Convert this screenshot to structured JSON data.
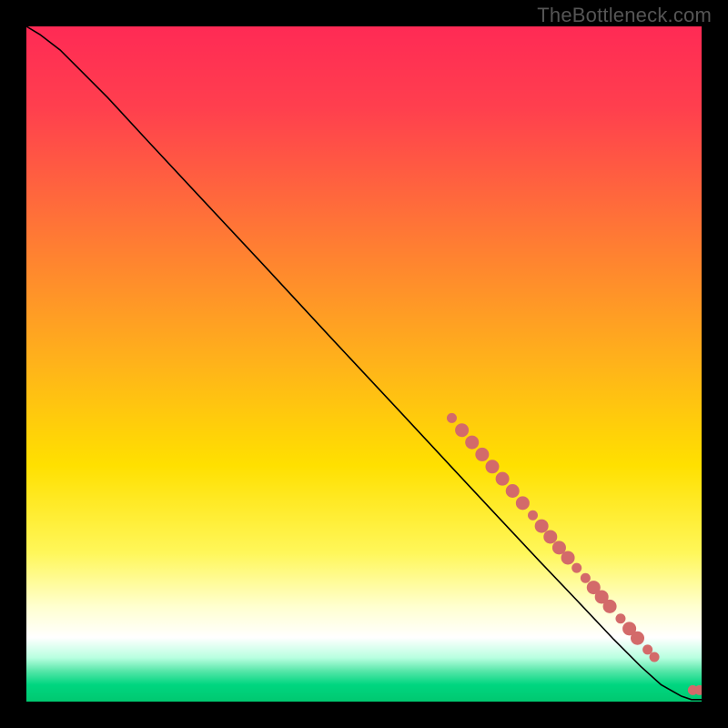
{
  "watermark": "TheBottleneck.com",
  "chart_data": {
    "type": "line",
    "title": "",
    "xlabel": "",
    "ylabel": "",
    "xlim": [
      0,
      100
    ],
    "ylim": [
      0,
      100
    ],
    "grid": false,
    "background_gradient": {
      "stops": [
        {
          "offset": 0.0,
          "color": "#ff2a55"
        },
        {
          "offset": 0.12,
          "color": "#ff3f4e"
        },
        {
          "offset": 0.3,
          "color": "#ff7636"
        },
        {
          "offset": 0.5,
          "color": "#ffb31a"
        },
        {
          "offset": 0.65,
          "color": "#ffe000"
        },
        {
          "offset": 0.78,
          "color": "#fff75a"
        },
        {
          "offset": 0.86,
          "color": "#ffffd0"
        },
        {
          "offset": 0.905,
          "color": "#ffffff"
        },
        {
          "offset": 0.935,
          "color": "#b8ffe0"
        },
        {
          "offset": 0.955,
          "color": "#55e6a8"
        },
        {
          "offset": 0.975,
          "color": "#00d680"
        },
        {
          "offset": 1.0,
          "color": "#00c870"
        }
      ]
    },
    "series": [
      {
        "name": "curve",
        "kind": "line",
        "color": "#000000",
        "x": [
          0,
          2,
          5,
          8,
          12,
          18,
          25,
          35,
          45,
          55,
          63,
          70,
          76,
          82,
          87,
          91,
          94,
          97,
          98.5,
          100
        ],
        "y": [
          100,
          98.8,
          96.5,
          93.5,
          89.5,
          83.0,
          75.5,
          64.8,
          54.0,
          43.3,
          34.7,
          27.2,
          20.8,
          14.5,
          9.2,
          5.2,
          2.5,
          0.8,
          0.3,
          0.3
        ]
      },
      {
        "name": "dots",
        "kind": "scatter",
        "color": "#d36a6a",
        "radius_small": 5.5,
        "radius_large": 7.5,
        "points": [
          {
            "x": 63.0,
            "y": 42.0,
            "r": "small"
          },
          {
            "x": 64.5,
            "y": 40.2,
            "r": "large"
          },
          {
            "x": 66.0,
            "y": 38.4,
            "r": "large"
          },
          {
            "x": 67.5,
            "y": 36.6,
            "r": "large"
          },
          {
            "x": 69.0,
            "y": 34.8,
            "r": "large"
          },
          {
            "x": 70.5,
            "y": 33.0,
            "r": "large"
          },
          {
            "x": 72.0,
            "y": 31.2,
            "r": "large"
          },
          {
            "x": 73.5,
            "y": 29.4,
            "r": "large"
          },
          {
            "x": 75.0,
            "y": 27.6,
            "r": "small"
          },
          {
            "x": 76.3,
            "y": 26.0,
            "r": "large"
          },
          {
            "x": 77.6,
            "y": 24.4,
            "r": "large"
          },
          {
            "x": 78.9,
            "y": 22.8,
            "r": "large"
          },
          {
            "x": 80.2,
            "y": 21.3,
            "r": "large"
          },
          {
            "x": 81.5,
            "y": 19.8,
            "r": "small"
          },
          {
            "x": 82.8,
            "y": 18.3,
            "r": "small"
          },
          {
            "x": 84.0,
            "y": 16.9,
            "r": "large"
          },
          {
            "x": 85.2,
            "y": 15.5,
            "r": "large"
          },
          {
            "x": 86.4,
            "y": 14.1,
            "r": "large"
          },
          {
            "x": 88.0,
            "y": 12.3,
            "r": "small"
          },
          {
            "x": 89.3,
            "y": 10.8,
            "r": "large"
          },
          {
            "x": 90.5,
            "y": 9.4,
            "r": "large"
          },
          {
            "x": 92.0,
            "y": 7.7,
            "r": "small"
          },
          {
            "x": 93.0,
            "y": 6.6,
            "r": "small"
          },
          {
            "x": 98.7,
            "y": 1.7,
            "r": "small"
          },
          {
            "x": 99.7,
            "y": 1.7,
            "r": "small"
          }
        ]
      }
    ]
  }
}
